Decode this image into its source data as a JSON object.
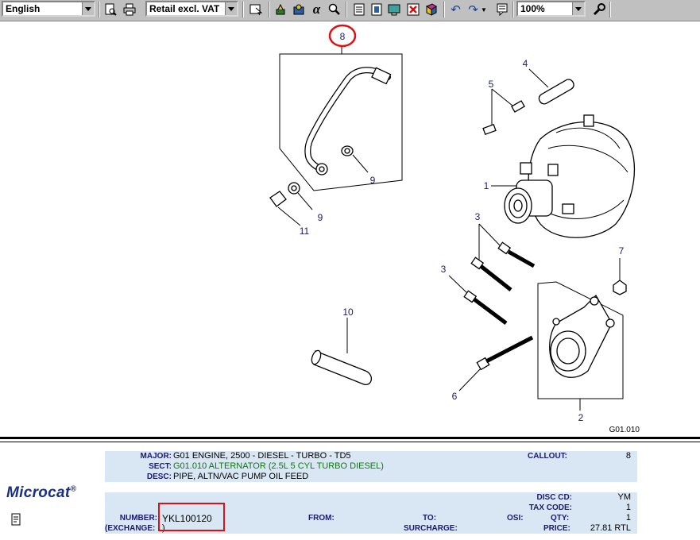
{
  "toolbar": {
    "language": "English",
    "price_mode": "Retail excl. VAT",
    "zoom": "100%",
    "icons": [
      "print-preview-icon",
      "print-icon",
      "pointer-icon",
      "tool-a-icon",
      "tool-b-icon",
      "alpha-icon",
      "search-icon",
      "list-icon",
      "info-icon",
      "monitor-icon",
      "close-icon",
      "book-icon",
      "undo-icon",
      "redo-icon",
      "note-icon",
      "wrench-icon"
    ]
  },
  "diagram": {
    "callouts": [
      "8",
      "4",
      "5",
      "1",
      "9",
      "9",
      "11",
      "3",
      "3",
      "7",
      "10",
      "6",
      "2"
    ],
    "reference": "G01.010"
  },
  "info": {
    "major_label": "MAJOR:",
    "major_value": "G01  ENGINE, 2500 - DIESEL - TURBO - TD5",
    "sect_label": "SECT:",
    "sect_value": "G01.010   ALTERNATOR (2.5L 5 CYL TURBO DIESEL)",
    "desc_label": "DESC:",
    "desc_value": "PIPE, ALTN/VAC PUMP OIL FEED",
    "callout_label": "CALLOUT:",
    "callout_value": "8",
    "disc_label": "DISC CD:",
    "disc_value": "YM",
    "tax_label": "TAX CODE:",
    "tax_value": "1",
    "number_label": "NUMBER:",
    "number_value": "YKL100120",
    "from_label": "FROM:",
    "to_label": "TO:",
    "osi_label": "OSI:",
    "qty_label": "QTY:",
    "qty_value": "1",
    "exchange_label": "(EXCHANGE:",
    "exchange_value": ")",
    "surcharge_label": "SURCHARGE:",
    "price_label": "PRICE:",
    "price_value": "27.81 RTL"
  },
  "brand": {
    "name": "Microcat",
    "mark": "®"
  }
}
